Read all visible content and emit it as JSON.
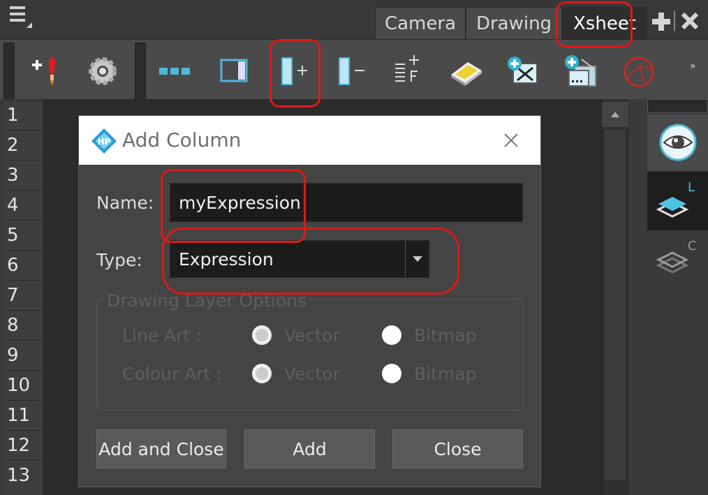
{
  "tabs": [
    {
      "label": "Camera",
      "active": false
    },
    {
      "label": "Drawing",
      "active": false
    },
    {
      "label": "Xsheet",
      "active": true
    }
  ],
  "tab_controls": {
    "add": "add-view-icon",
    "close": "close-view-icon"
  },
  "toolbar": {
    "icons": [
      "add-drawing-icon",
      "layer-properties-gear-icon",
      "show-thumbnails-icon",
      "toggle-column-icon",
      "add-column-icon",
      "delete-column-icon",
      "add-frames-icon",
      "scan-icon",
      "import-images-icon",
      "import-to-column-icon",
      "onion-skin-icon"
    ],
    "overflow": "»"
  },
  "row_numbers": [
    "1",
    "2",
    "3",
    "4",
    "5",
    "6",
    "7",
    "8",
    "9",
    "10",
    "11",
    "12",
    "13"
  ],
  "right_panel": {
    "layer_l": "L",
    "layer_c": "C"
  },
  "dialog": {
    "title": "Add Column",
    "name_label": "Name:",
    "name_value": "myExpression",
    "type_label": "Type:",
    "type_value": "Expression",
    "group_title": "Drawing Layer Options",
    "line_art_label": "Line Art :",
    "colour_art_label": "Colour Art :",
    "vector_label": "Vector",
    "bitmap_label": "Bitmap",
    "buttons": {
      "add_close": "Add and Close",
      "add": "Add",
      "close": "Close"
    }
  },
  "colors": {
    "accent_red": "#e01818",
    "dialog_bg": "#444444",
    "field_bg": "#1c1c1c"
  }
}
